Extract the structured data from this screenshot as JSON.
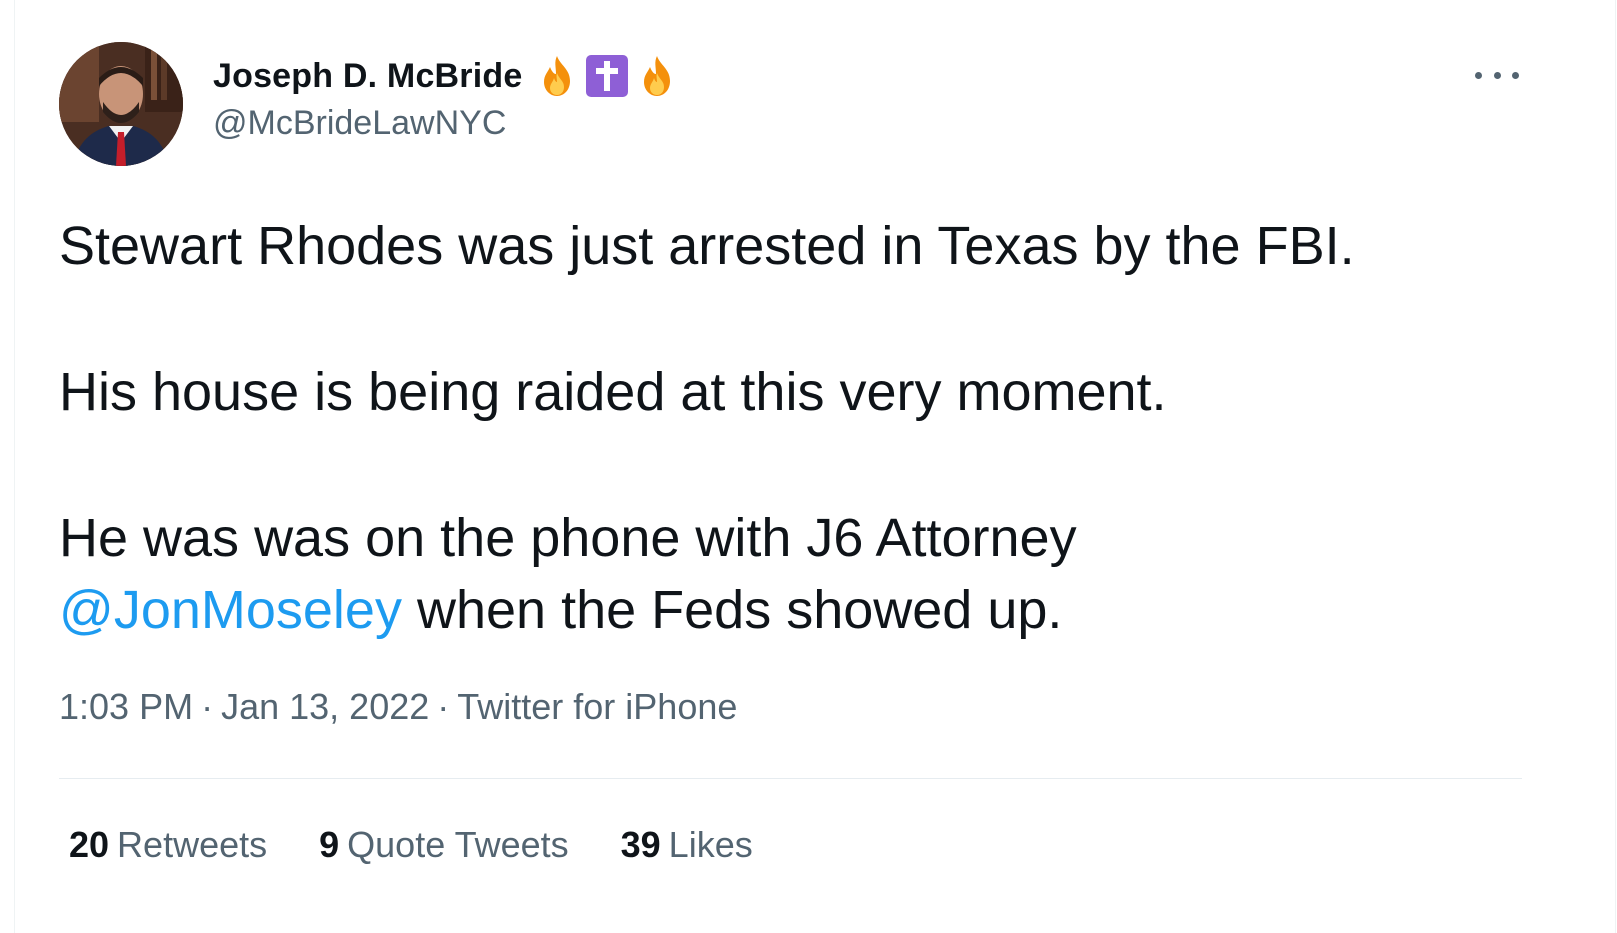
{
  "author": {
    "display_name": "Joseph D. McBride",
    "handle": "@McBrideLawNYC",
    "badges": [
      "fire-emoji",
      "latin-cross-emoji",
      "fire-emoji"
    ]
  },
  "tweet": {
    "paragraph_1": "Stewart Rhodes was just arrested in Texas by the FBI.",
    "paragraph_2": "His house is being raided at this very moment.",
    "paragraph_3_start": "He was was on the phone with J6 Attorney",
    "mention": "@JonMoseley",
    "paragraph_3_end": " when the Feds showed up."
  },
  "meta": {
    "time": "1:03 PM",
    "separator": "·",
    "date": "Jan 13, 2022",
    "source": "Twitter for iPhone"
  },
  "stats": {
    "retweets_count": "20",
    "retweets_label": "Retweets",
    "quotes_count": "9",
    "quotes_label": "Quote Tweets",
    "likes_count": "39",
    "likes_label": "Likes"
  },
  "colors": {
    "text": "#0f1419",
    "secondary": "#536471",
    "link": "#1d9bf0",
    "divider": "#e6ecf0",
    "cross_badge": "#8e5fd6"
  }
}
